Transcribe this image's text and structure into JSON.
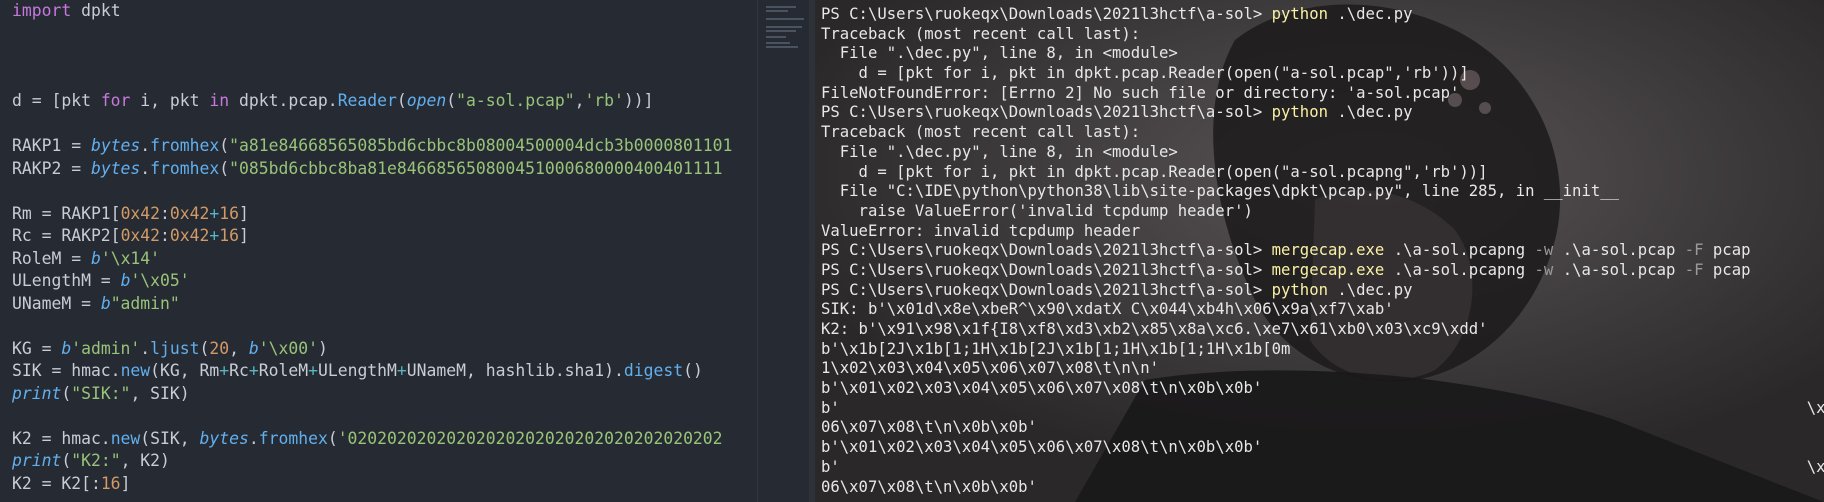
{
  "editor": {
    "lines": [
      [
        {
          "t": "import",
          "c": "kw"
        },
        {
          "t": " dpkt",
          "c": "plain"
        }
      ],
      [],
      [],
      [],
      [
        {
          "t": "d = [pkt ",
          "c": "plain"
        },
        {
          "t": "for",
          "c": "kw"
        },
        {
          "t": " i, pkt ",
          "c": "plain"
        },
        {
          "t": "in",
          "c": "kw"
        },
        {
          "t": " dpkt.pcap.",
          "c": "plain"
        },
        {
          "t": "Reader",
          "c": "fn"
        },
        {
          "t": "(",
          "c": "plain"
        },
        {
          "t": "open",
          "c": "it"
        },
        {
          "t": "(",
          "c": "plain"
        },
        {
          "t": "\"a-sol.pcap\"",
          "c": "str"
        },
        {
          "t": ",",
          "c": "plain"
        },
        {
          "t": "'rb'",
          "c": "str"
        },
        {
          "t": "))]",
          "c": "plain"
        }
      ],
      [],
      [
        {
          "t": "RAKP1 = ",
          "c": "plain"
        },
        {
          "t": "bytes",
          "c": "it"
        },
        {
          "t": ".",
          "c": "plain"
        },
        {
          "t": "fromhex",
          "c": "fn"
        },
        {
          "t": "(",
          "c": "plain"
        },
        {
          "t": "\"a81e84668565085bd6cbbc8b08004500004dcb3b0000801101",
          "c": "str"
        }
      ],
      [
        {
          "t": "RAKP2 = ",
          "c": "plain"
        },
        {
          "t": "bytes",
          "c": "it"
        },
        {
          "t": ".",
          "c": "plain"
        },
        {
          "t": "fromhex",
          "c": "fn"
        },
        {
          "t": "(",
          "c": "plain"
        },
        {
          "t": "\"085bd6cbbc8ba81e846685650800451000680000400401111",
          "c": "str"
        }
      ],
      [],
      [
        {
          "t": "Rm = RAKP1[",
          "c": "plain"
        },
        {
          "t": "0x42",
          "c": "num"
        },
        {
          "t": ":",
          "c": "plain"
        },
        {
          "t": "0x42",
          "c": "num"
        },
        {
          "t": "+",
          "c": "op"
        },
        {
          "t": "16",
          "c": "num"
        },
        {
          "t": "]",
          "c": "plain"
        }
      ],
      [
        {
          "t": "Rc = RAKP2[",
          "c": "plain"
        },
        {
          "t": "0x42",
          "c": "num"
        },
        {
          "t": ":",
          "c": "plain"
        },
        {
          "t": "0x42",
          "c": "num"
        },
        {
          "t": "+",
          "c": "op"
        },
        {
          "t": "16",
          "c": "num"
        },
        {
          "t": "]",
          "c": "plain"
        }
      ],
      [
        {
          "t": "RoleM = ",
          "c": "plain"
        },
        {
          "t": "b",
          "c": "it"
        },
        {
          "t": "'\\x14'",
          "c": "str"
        }
      ],
      [
        {
          "t": "ULengthM = ",
          "c": "plain"
        },
        {
          "t": "b",
          "c": "it"
        },
        {
          "t": "'\\x05'",
          "c": "str"
        }
      ],
      [
        {
          "t": "UNameM = ",
          "c": "plain"
        },
        {
          "t": "b",
          "c": "it"
        },
        {
          "t": "\"admin\"",
          "c": "str"
        }
      ],
      [],
      [
        {
          "t": "KG = ",
          "c": "plain"
        },
        {
          "t": "b",
          "c": "it"
        },
        {
          "t": "'admin'",
          "c": "str"
        },
        {
          "t": ".",
          "c": "plain"
        },
        {
          "t": "ljust",
          "c": "fn"
        },
        {
          "t": "(",
          "c": "plain"
        },
        {
          "t": "20",
          "c": "num"
        },
        {
          "t": ", ",
          "c": "plain"
        },
        {
          "t": "b",
          "c": "it"
        },
        {
          "t": "'\\x00'",
          "c": "str"
        },
        {
          "t": ")",
          "c": "plain"
        }
      ],
      [
        {
          "t": "SIK = hmac.",
          "c": "plain"
        },
        {
          "t": "new",
          "c": "fn"
        },
        {
          "t": "(KG, Rm",
          "c": "plain"
        },
        {
          "t": "+",
          "c": "op"
        },
        {
          "t": "Rc",
          "c": "plain"
        },
        {
          "t": "+",
          "c": "op"
        },
        {
          "t": "RoleM",
          "c": "plain"
        },
        {
          "t": "+",
          "c": "op"
        },
        {
          "t": "ULengthM",
          "c": "plain"
        },
        {
          "t": "+",
          "c": "op"
        },
        {
          "t": "UNameM, hashlib.sha1).",
          "c": "plain"
        },
        {
          "t": "digest",
          "c": "fn"
        },
        {
          "t": "()",
          "c": "plain"
        }
      ],
      [
        {
          "t": "print",
          "c": "it"
        },
        {
          "t": "(",
          "c": "plain"
        },
        {
          "t": "\"SIK:\"",
          "c": "str"
        },
        {
          "t": ", SIK)",
          "c": "plain"
        }
      ],
      [],
      [
        {
          "t": "K2 = hmac.",
          "c": "plain"
        },
        {
          "t": "new",
          "c": "fn"
        },
        {
          "t": "(SIK, ",
          "c": "plain"
        },
        {
          "t": "bytes",
          "c": "it"
        },
        {
          "t": ".",
          "c": "plain"
        },
        {
          "t": "fromhex",
          "c": "fn"
        },
        {
          "t": "(",
          "c": "plain"
        },
        {
          "t": "'02020202020202020202020202020202020202",
          "c": "str"
        }
      ],
      [
        {
          "t": "print",
          "c": "it"
        },
        {
          "t": "(",
          "c": "plain"
        },
        {
          "t": "\"K2:\"",
          "c": "str"
        },
        {
          "t": ", K2)",
          "c": "plain"
        }
      ],
      [
        {
          "t": "K2 = K2[:",
          "c": "plain"
        },
        {
          "t": "16",
          "c": "num"
        },
        {
          "t": "]",
          "c": "plain"
        }
      ]
    ]
  },
  "terminal": {
    "lines": [
      [
        {
          "t": "PS C:\\Users\\ruokeqx\\Downloads\\2021l3hctf\\a-sol> ",
          "c": ""
        },
        {
          "t": "python",
          "c": "cmd"
        },
        {
          "t": " .\\dec.py",
          "c": ""
        }
      ],
      [
        {
          "t": "Traceback (most recent call last):",
          "c": ""
        }
      ],
      [
        {
          "t": "  File \".\\dec.py\", line 8, in <module>",
          "c": ""
        }
      ],
      [
        {
          "t": "    d = [pkt for i, pkt in dpkt.pcap.Reader(open(\"a-sol.pcap\",'rb'))]",
          "c": ""
        }
      ],
      [
        {
          "t": "FileNotFoundError: [Errno 2] No such file or directory: 'a-sol.pcap'",
          "c": ""
        }
      ],
      [
        {
          "t": "PS C:\\Users\\ruokeqx\\Downloads\\2021l3hctf\\a-sol> ",
          "c": ""
        },
        {
          "t": "python",
          "c": "cmd"
        },
        {
          "t": " .\\dec.py",
          "c": ""
        }
      ],
      [
        {
          "t": "Traceback (most recent call last):",
          "c": ""
        }
      ],
      [
        {
          "t": "  File \".\\dec.py\", line 8, in <module>",
          "c": ""
        }
      ],
      [
        {
          "t": "    d = [pkt for i, pkt in dpkt.pcap.Reader(open(\"a-sol.pcapng\",'rb'))]",
          "c": ""
        }
      ],
      [
        {
          "t": "  File \"C:\\IDE\\python\\python38\\lib\\site-packages\\dpkt\\pcap.py\", line 285, in __init__",
          "c": ""
        }
      ],
      [
        {
          "t": "    raise ValueError('invalid tcpdump header')",
          "c": ""
        }
      ],
      [
        {
          "t": "ValueError: invalid tcpdump header",
          "c": ""
        }
      ],
      [
        {
          "t": "PS C:\\Users\\ruokeqx\\Downloads\\2021l3hctf\\a-sol> ",
          "c": ""
        },
        {
          "t": "mergecap.exe",
          "c": "cmd"
        },
        {
          "t": " .\\a-sol.pcapng ",
          "c": ""
        },
        {
          "t": "-w",
          "c": "flag"
        },
        {
          "t": " .\\a-sol.pcap ",
          "c": ""
        },
        {
          "t": "-F",
          "c": "flag"
        },
        {
          "t": " pcap",
          "c": ""
        }
      ],
      [
        {
          "t": "PS C:\\Users\\ruokeqx\\Downloads\\2021l3hctf\\a-sol> ",
          "c": ""
        },
        {
          "t": "mergecap.exe",
          "c": "cmd"
        },
        {
          "t": " .\\a-sol.pcapng ",
          "c": ""
        },
        {
          "t": "-w",
          "c": "flag"
        },
        {
          "t": " .\\a-sol.pcap ",
          "c": ""
        },
        {
          "t": "-F",
          "c": "flag"
        },
        {
          "t": " pcap",
          "c": ""
        }
      ],
      [
        {
          "t": "PS C:\\Users\\ruokeqx\\Downloads\\2021l3hctf\\a-sol> ",
          "c": ""
        },
        {
          "t": "python",
          "c": "cmd"
        },
        {
          "t": " .\\dec.py",
          "c": ""
        }
      ],
      [
        {
          "t": "SIK: b'\\x01d\\x8e\\xbeR^\\x90\\xdatX C\\x044\\xb4h\\x06\\x9a\\xf7\\xab'",
          "c": ""
        }
      ],
      [
        {
          "t": "K2: b'\\x91\\x98\\x1f{I8\\xf8\\xd3\\xb2\\x85\\x8a\\xc6.\\xe7\\x61\\xb0\\x03\\xc9\\xdd'",
          "c": ""
        }
      ],
      [
        {
          "t": "b'\\x1b[2J\\x1b[1;1H\\x1b[2J\\x1b[1;1H\\x1b[1;1H\\x1b[0m",
          "c": ""
        }
      ],
      [
        {
          "t": "1\\x02\\x03\\x04\\x05\\x06\\x07\\x08\\t\\n\\n'",
          "c": ""
        }
      ],
      [
        {
          "t": "b'\\x01\\x02\\x03\\x04\\x05\\x06\\x07\\x08\\t\\n\\x0b\\x0b'",
          "c": ""
        }
      ],
      [
        {
          "t": "b'                                                                                                       \\x",
          "c": ""
        }
      ],
      [
        {
          "t": "06\\x07\\x08\\t\\n\\x0b\\x0b'",
          "c": ""
        }
      ],
      [
        {
          "t": "b'\\x01\\x02\\x03\\x04\\x05\\x06\\x07\\x08\\t\\n\\x0b\\x0b'",
          "c": ""
        }
      ],
      [
        {
          "t": "b'                                                                                                       \\x",
          "c": ""
        }
      ],
      [
        {
          "t": "06\\x07\\x08\\t\\n\\x0b\\x0b'",
          "c": ""
        }
      ]
    ]
  }
}
